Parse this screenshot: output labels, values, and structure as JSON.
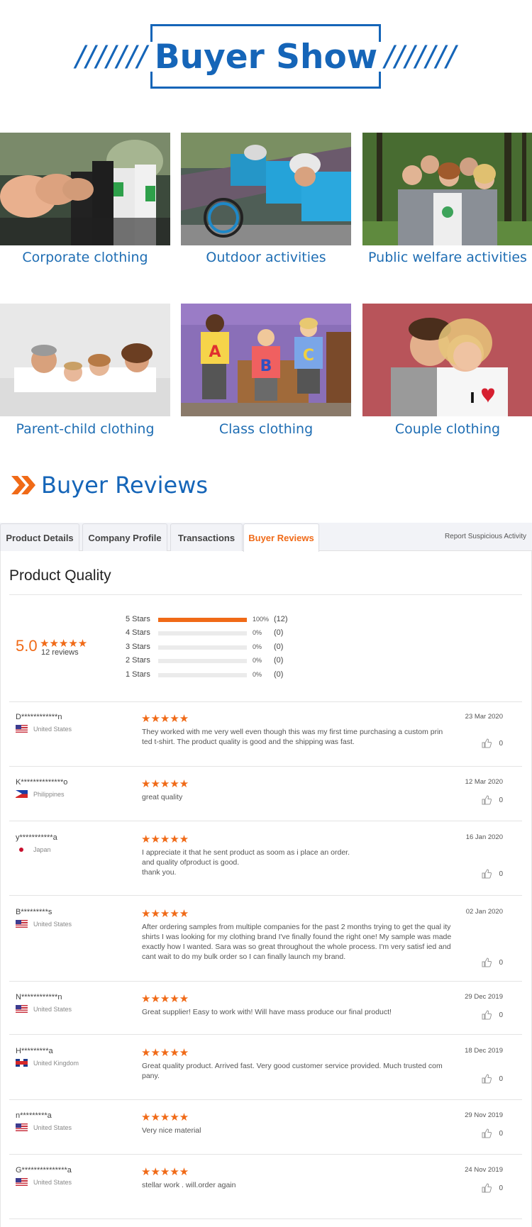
{
  "show": {
    "title": "Buyer Show",
    "slashes_left": "///////",
    "slashes_right": "///////"
  },
  "photos": [
    {
      "caption": "Corporate clothing",
      "image": "thumbs-up-group-photo"
    },
    {
      "caption": "Outdoor activities",
      "image": "cyclists-photo"
    },
    {
      "caption": "Public welfare activities",
      "image": "friends-in-forest-photo"
    },
    {
      "caption": "Parent-child clothing",
      "image": "family-lying-photo"
    },
    {
      "caption": "Class clothing",
      "image": "kids-abc-shirts-photo"
    },
    {
      "caption": "Couple clothing",
      "image": "couple-photo"
    }
  ],
  "reviews_heading": "Buyer Reviews",
  "tabs": [
    {
      "label": "Product Details",
      "active": false
    },
    {
      "label": "Company Profile",
      "active": false
    },
    {
      "label": "Transactions",
      "active": false
    },
    {
      "label": "Buyer Reviews",
      "active": true
    }
  ],
  "report_link": "Report Suspicious Activity",
  "summary": {
    "title": "Product Quality",
    "score": "5.0",
    "stars": "★★★★★",
    "count_text": "12 reviews",
    "distribution": [
      {
        "label": "5 Stars",
        "fraction": 1.0,
        "pct": "100%",
        "count": "(12)"
      },
      {
        "label": "4 Stars",
        "fraction": 0.0,
        "pct": "0%",
        "count": "(0)"
      },
      {
        "label": "3 Stars",
        "fraction": 0.0,
        "pct": "0%",
        "count": "(0)"
      },
      {
        "label": "2 Stars",
        "fraction": 0.0,
        "pct": "0%",
        "count": "(0)"
      },
      {
        "label": "1 Stars",
        "fraction": 0.0,
        "pct": "0%",
        "count": "(0)"
      }
    ]
  },
  "accent_color": "#f06a17",
  "brand_blue": "#1565b8",
  "reviews": [
    {
      "name": "D************n",
      "country": "United States",
      "flag": "us",
      "stars": "★★★★★",
      "date": "23 Mar 2020",
      "likes": "0",
      "text": "They worked with me very well even though this was my first time purchasing a custom prin ted t-shirt. The product quality is good and the shipping was fast."
    },
    {
      "name": "K**************o",
      "country": "Philippines",
      "flag": "ph",
      "stars": "★★★★★",
      "date": "12 Mar 2020",
      "likes": "0",
      "text": "great quality"
    },
    {
      "name": "y***********a",
      "country": "Japan",
      "flag": "jp",
      "stars": "★★★★★",
      "date": "16 Jan 2020",
      "likes": "0",
      "text": "I appreciate it that he sent product as soom as i place an order.\nand quality ofproduct is good.\nthank you."
    },
    {
      "name": "B*********s",
      "country": "United States",
      "flag": "us",
      "stars": "★★★★★",
      "date": "02 Jan 2020",
      "likes": "0",
      "text": "After ordering samples from multiple companies for the past 2 months trying to get the qual ity shirts I was looking for my clothing brand I've finally found the right one! My sample was made exactly how I wanted. Sara was so great throughout the whole process. I'm very satisf ied and cant wait to do my bulk order so I can finally launch my brand."
    },
    {
      "name": "N************n",
      "country": "United States",
      "flag": "us",
      "stars": "★★★★★",
      "date": "29 Dec 2019",
      "likes": "0",
      "text": "Great supplier! Easy to work with! Will have mass produce our final product!"
    },
    {
      "name": "H*********a",
      "country": "United Kingdom",
      "flag": "uk",
      "stars": "★★★★★",
      "date": "18 Dec 2019",
      "likes": "0",
      "text": "Great quality product. Arrived fast. Very good customer service provided. Much trusted com pany."
    },
    {
      "name": "n*********a",
      "country": "United States",
      "flag": "us",
      "stars": "★★★★★",
      "date": "29 Nov 2019",
      "likes": "0",
      "text": "Very nice material"
    },
    {
      "name": "G***************a",
      "country": "United States",
      "flag": "us",
      "stars": "★★★★★",
      "date": "24 Nov 2019",
      "likes": "0",
      "text": "stellar work . will.order again"
    }
  ]
}
